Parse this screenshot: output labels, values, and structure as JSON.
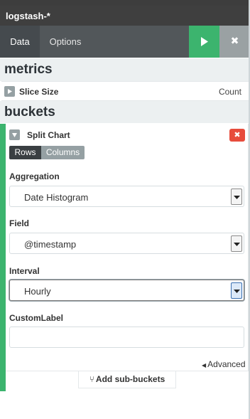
{
  "index": {
    "title": "logstash-*"
  },
  "tabs": [
    {
      "label": "Data"
    },
    {
      "label": "Options"
    }
  ],
  "actions": {
    "apply_icon": "play-icon",
    "discard_icon": "close-icon"
  },
  "metrics": {
    "heading": "metrics",
    "items": [
      {
        "label": "Slice Size",
        "aggregation": "Count"
      }
    ]
  },
  "buckets": {
    "heading": "buckets",
    "items": [
      {
        "label": "Split Chart",
        "split_mode": {
          "options": [
            "Rows",
            "Columns"
          ],
          "selected": "Rows"
        },
        "fields": {
          "aggregation": {
            "label": "Aggregation",
            "value": "Date Histogram"
          },
          "field": {
            "label": "Field",
            "value": "@timestamp"
          },
          "interval": {
            "label": "Interval",
            "value": "Hourly"
          },
          "custom_label": {
            "label": "CustomLabel",
            "value": ""
          }
        },
        "advanced_label": "Advanced"
      }
    ],
    "add_sub_label": "Add sub-buckets"
  },
  "colors": {
    "accent_green": "#3cb46e",
    "remove_red": "#e74c3c",
    "header_dark": "#3f3f3f"
  }
}
